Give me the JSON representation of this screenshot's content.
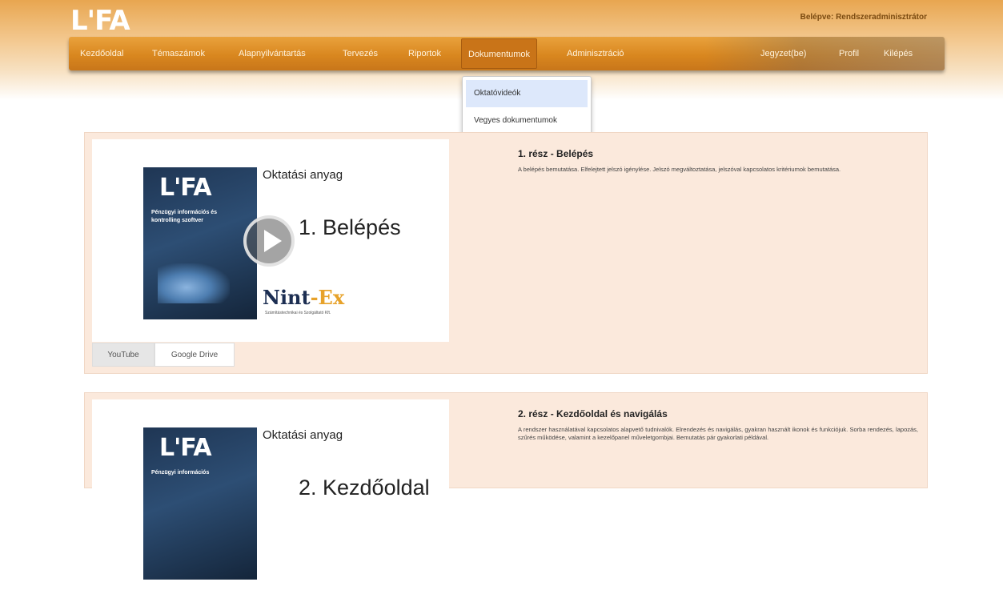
{
  "header": {
    "logo": "L'FA",
    "user_info": "Belépve: Rendszeradminisztrátor"
  },
  "nav": {
    "items": [
      {
        "label": "Kezdőoldal"
      },
      {
        "label": "Témaszámok"
      },
      {
        "label": "Alapnyilvántartás"
      },
      {
        "label": "Tervezés"
      },
      {
        "label": "Riportok"
      },
      {
        "label": "Dokumentumok"
      },
      {
        "label": "Adminisztráció"
      }
    ],
    "right_items": [
      {
        "label": "Jegyzet(be)"
      },
      {
        "label": "Profil"
      },
      {
        "label": "Kilépés"
      }
    ]
  },
  "dropdown": {
    "items": [
      {
        "label": "Oktatóvideók"
      },
      {
        "label": "Vegyes dokumentumok"
      }
    ]
  },
  "videos": [
    {
      "thumb_logo": "L'FA",
      "thumb_cover_text": "Pénzügyi információs és kontrolling szoftver",
      "thumb_material": "Oktatási anyag",
      "thumb_part": "1. Belépés",
      "brand_a": "Nint",
      "brand_b": "-Ex",
      "brand_sub": "Számítástechnikai és Szolgáltató Kft.",
      "tab_youtube": "YouTube",
      "tab_drive": "Google Drive",
      "title": "1. rész - Belépés",
      "description": "A belépés bemutatása. Elfelejtett jelszó igénylése. Jelszó megváltoztatása, jelszóval kapcsolatos kritériumok bemutatása."
    },
    {
      "thumb_logo": "L'FA",
      "thumb_cover_text": "Pénzügyi információs",
      "thumb_material": "Oktatási anyag",
      "thumb_part": "2. Kezdőoldal",
      "title": "2. rész - Kezdőoldal és navigálás",
      "description": "A rendszer használatával kapcsolatos alapvető tudnivalók. Elrendezés és navigálás, gyakran használt ikonok és funkciójuk. Sorba rendezés, lapozás, szűrés működése, valamint a kezelőpanel műveletgombjai. Bemutatás pár gyakorlati példával."
    }
  ]
}
